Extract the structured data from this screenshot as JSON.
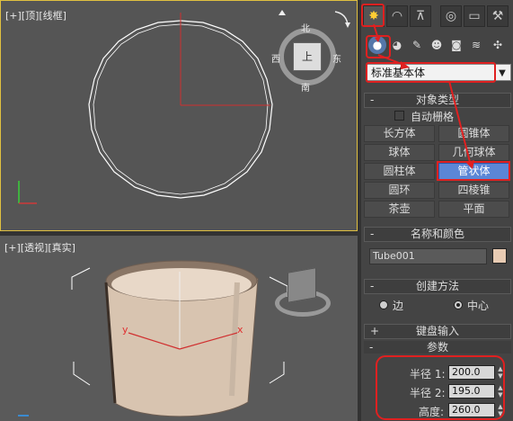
{
  "viewport_top": {
    "label": "[+][顶][线框]"
  },
  "viewport_persp": {
    "label": "[+][透视][真实]"
  },
  "viewcube": {
    "top": "北",
    "left": "西",
    "right": "东",
    "bottom": "南",
    "face": "上"
  },
  "command_panel": {
    "tabs": [
      "create-icon",
      "modify-icon",
      "hierarchy-icon",
      "motion-icon",
      "display-icon",
      "utilities-icon"
    ],
    "category_selector": "标准基本体",
    "object_type": {
      "title": "对象类型",
      "autogrid": "自动栅格",
      "buttons": [
        "长方体",
        "圆锥体",
        "球体",
        "几何球体",
        "圆柱体",
        "管状体",
        "圆环",
        "四棱锥",
        "茶壶",
        "平面"
      ],
      "active": "管状体"
    },
    "name_color": {
      "title": "名称和颜色",
      "name": "Tube001",
      "color": "#e8cbb3"
    },
    "creation_method": {
      "title": "创建方法",
      "edge": "边",
      "center": "中心",
      "selected": "中心"
    },
    "keyboard_entry": {
      "title": "键盘输入"
    },
    "parameters": {
      "title": "参数",
      "radius1_label": "半径 1:",
      "radius1": "200.0",
      "radius2_label": "半径 2:",
      "radius2": "195.0",
      "height_label": "高度:",
      "height": "260.0"
    }
  },
  "colors": {
    "highlight": "#e02020",
    "active_button": "#5b86d6",
    "viewport_border": "#e0c040"
  }
}
